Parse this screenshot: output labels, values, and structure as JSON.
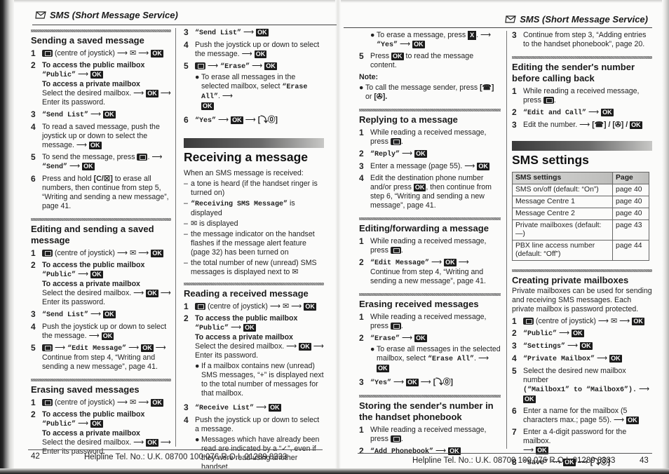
{
  "running_head": "SMS (Short Message Service)",
  "left_page": {
    "number": "42",
    "helpline": "Helpline Tel. No.: U.K. 08700 100 076  R.O.I. 01289 8333",
    "col1": {
      "sending_saved": {
        "heading": "Sending a saved message",
        "step1": {
          "n": "1",
          "text": "(centre of joystick)"
        },
        "step2": {
          "n": "2",
          "public_label": "To access the public mailbox",
          "public_value": "“Public”",
          "private_label": "To access a private mailbox",
          "private_text": "Select the desired mailbox.",
          "password": "Enter its password."
        },
        "step3": {
          "n": "3",
          "value": "“Send List”"
        },
        "step4": {
          "n": "4",
          "text": "To read a saved message, push the joystick up or down to select the message."
        },
        "step5": {
          "n": "5",
          "text": "To send the message, press",
          "value": "“Send”"
        },
        "step6": {
          "n": "6",
          "text_a": "Press and hold",
          "key": "[C/☒]",
          "text_b": "to erase all numbers, then continue from step 5, “Writing and sending a new message”, page 41."
        }
      },
      "editing_saved": {
        "heading": "Editing and sending a saved message",
        "step1": {
          "n": "1",
          "text": "(centre of joystick)"
        },
        "step2": {
          "n": "2",
          "public_label": "To access the public mailbox",
          "public_value": "“Public”",
          "private_label": "To access a private mailbox",
          "private_text": "Select the desired mailbox.",
          "password": "Enter its password."
        },
        "step3": {
          "n": "3",
          "value": "“Send List”"
        },
        "step4": {
          "n": "4",
          "text": "Push the joystick up or down to select the message."
        },
        "step5": {
          "n": "5",
          "value": "“Edit Message”",
          "text": "Continue from step 4, “Writing and sending a new message”, page 41."
        }
      },
      "erasing_saved": {
        "heading": "Erasing saved messages",
        "step1": {
          "n": "1",
          "text": "(centre of joystick)"
        },
        "step2": {
          "n": "2",
          "public_label": "To access the public mailbox",
          "public_value": "“Public”",
          "private_label": "To access a private mailbox",
          "private_text": "Select the desired mailbox.",
          "password": "Enter its password."
        }
      }
    },
    "col2": {
      "cont": {
        "step3": {
          "n": "3",
          "value": "“Send List”"
        },
        "step4": {
          "n": "4",
          "text": "Push the joystick up or down to select the message."
        },
        "step5": {
          "n": "5",
          "value": "“Erase”",
          "bullet_a": "To erase all messages in the selected mailbox, select",
          "bullet_value": "“Erase All”"
        },
        "step6": {
          "n": "6",
          "value": "“Yes”",
          "key": "[⤵⓪]"
        }
      },
      "receiving": {
        "heading": "Receiving a message",
        "intro": "When an SMS message is received:",
        "d1": "a tone is heard (if the handset ringer is turned on)",
        "d2_value": "“Receiving SMS Message”",
        "d2_text": "is displayed",
        "d3": "is displayed",
        "d4": "the message indicator on the handset flashes if the message alert feature (page 32) has been turned on",
        "d5": "the total number of new (unread) SMS messages is displayed next to"
      },
      "reading": {
        "heading": "Reading a received message",
        "step1": {
          "n": "1",
          "text": "(centre of joystick)"
        },
        "step2": {
          "n": "2",
          "public_label": "To access the public mailbox",
          "public_value": "“Public”",
          "private_label": "To access a private mailbox",
          "private_text": "Select the desired mailbox.",
          "password": "Enter its password.",
          "bullet": "If a mailbox contains new (unread) SMS messages, “+” is displayed next to the total number of messages for that mailbox."
        },
        "step3": {
          "n": "3",
          "value": "“Receive List”"
        },
        "step4": {
          "n": "4",
          "text": "Push the joystick up or down to select a message.",
          "bullet": "Messages which have already been read are indicated by a “✓”, even if they were read using another handset."
        }
      }
    }
  },
  "right_page": {
    "number": "43",
    "helpline": "Helpline Tel. No.: U.K. 08700 100 076  R.O.I. 01289 8333",
    "col3": {
      "cont": {
        "bullet_a": "To erase a message, press",
        "x_key": "X",
        "yes": "“Yes”",
        "step5": {
          "n": "5",
          "text_a": "Press",
          "text_b": "to read the message content."
        },
        "note_label": "Note:",
        "note_a": "To call the message sender, press",
        "note_key1": "[☎]",
        "note_b": "or",
        "note_key2": "[✇]."
      },
      "replying": {
        "heading": "Replying to a message",
        "step1": {
          "n": "1",
          "text": "While reading a received message, press"
        },
        "step2": {
          "n": "2",
          "value": "“Reply”"
        },
        "step3": {
          "n": "3",
          "text": "Enter a message (page 55)."
        },
        "step4": {
          "n": "4",
          "text_a": "Edit the destination phone number and/or press",
          "text_b": ", then continue from step 6, “Writing and sending a new message”, page 41."
        }
      },
      "editing_fwd": {
        "heading": "Editing/forwarding a message",
        "step1": {
          "n": "1",
          "text": "While reading a received message, press"
        },
        "step2": {
          "n": "2",
          "value": "“Edit Message”",
          "text": "Continue from step 4, “Writing and sending a new message”, page 41."
        }
      },
      "erasing_rcv": {
        "heading": "Erasing received messages",
        "step1": {
          "n": "1",
          "text": "While reading a received message, press"
        },
        "step2": {
          "n": "2",
          "value": "“Erase”",
          "bullet_a": "To erase all messages in the selected mailbox, select",
          "bullet_value": "“Erase All”"
        },
        "step3": {
          "n": "3",
          "value": "“Yes”",
          "key": "[⤵⓪]"
        }
      },
      "storing": {
        "heading": "Storing the sender's number in the handset phonebook",
        "step1": {
          "n": "1",
          "text": "While reading a received message, press"
        },
        "step2": {
          "n": "2",
          "value": "“Add Phonebook”"
        }
      }
    },
    "col4": {
      "cont": {
        "step3": {
          "n": "3",
          "text": "Continue from step 3, “Adding entries to the handset phonebook”, page 20."
        }
      },
      "editing_sender": {
        "heading": "Editing the sender's number before calling back",
        "step1": {
          "n": "1",
          "text": "While reading a received message, press"
        },
        "step2": {
          "n": "2",
          "value": "“Edit and Call”"
        },
        "step3": {
          "n": "3",
          "text": "Edit the number.",
          "keys": "[☎] / [✇] /"
        }
      },
      "sms_settings": {
        "heading": "SMS settings",
        "table": {
          "headers": [
            "SMS settings",
            "Page"
          ],
          "rows": [
            {
              "setting": "SMS on/off (default: “On”)",
              "page": "page 40"
            },
            {
              "setting": "Message Centre 1",
              "page": "page 40"
            },
            {
              "setting": "Message Centre 2",
              "page": "page 40"
            },
            {
              "setting": "Private mailboxes (default: —)",
              "page": "page 43"
            },
            {
              "setting": "PBX line access number (default: “Off”)",
              "page": "page 44"
            }
          ]
        }
      },
      "creating": {
        "heading": "Creating private mailboxes",
        "intro": "Private mailboxes can be used for sending and receiving SMS messages. Each private mailbox is password protected.",
        "step1": {
          "n": "1",
          "text": "(centre of joystick)"
        },
        "step2": {
          "n": "2",
          "value": "“Public”"
        },
        "step3": {
          "n": "3",
          "value": "“Settings”"
        },
        "step4": {
          "n": "4",
          "value": "“Private Mailbox”"
        },
        "step5": {
          "n": "5",
          "text": "Select the desired new mailbox number",
          "range": "(“Mailbox1” to “Mailbox6”)."
        },
        "step6": {
          "n": "6",
          "text": "Enter a name for the mailbox (5 characters max.; page 55)."
        },
        "step7": {
          "n": "7",
          "text": "Enter a 4-digit password for the mailbox."
        },
        "step8": {
          "n": "8",
          "value": "“Save”",
          "key": "[⤵⓪]"
        }
      }
    }
  },
  "glyphs": {
    "arrow": "⟶",
    "ok": "OK",
    "bullet": "●",
    "dash": "–"
  }
}
